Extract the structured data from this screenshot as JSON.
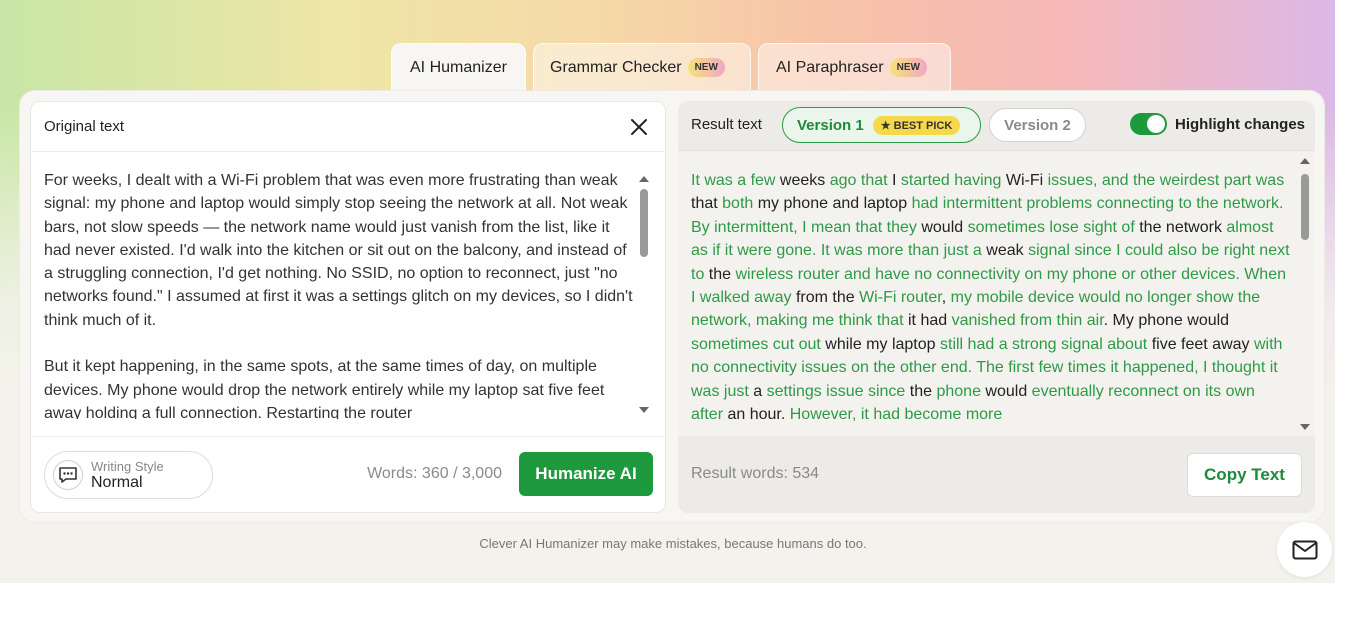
{
  "tabs": [
    {
      "label": "AI Humanizer",
      "badge": ""
    },
    {
      "label": "Grammar Checker",
      "badge": "NEW"
    },
    {
      "label": "AI Paraphraser",
      "badge": "NEW"
    }
  ],
  "input_panel": {
    "title": "Original text",
    "paragraphs": [
      "For weeks, I dealt with a Wi-Fi problem that was even more frustrating than weak signal: my phone and laptop would simply stop seeing the network at all. Not weak bars, not slow speeds — the network name would just vanish from the list, like it had never existed. I'd walk into the kitchen or sit out on the balcony, and instead of a struggling connection, I'd get nothing. No SSID, no option to reconnect, just \"no networks found.\" I assumed at first it was a settings glitch on my devices, so I didn't think much of it.",
      "But it kept happening, in the same spots, at the same times of day, on multiple devices. My phone would drop the network entirely while my laptop sat five feet away holding a full connection. Restarting the router"
    ],
    "writing_style_label": "Writing Style",
    "writing_style_value": "Normal",
    "word_count": "Words: 360 / 3,000",
    "humanize_button": "Humanize AI"
  },
  "result_panel": {
    "title": "Result text",
    "version1_label": "Version 1",
    "best_pick_badge": "★ BEST PICK",
    "version2_label": "Version 2",
    "highlight_label": "Highlight changes",
    "highlight_on": true,
    "segments": [
      {
        "t": "It was a few",
        "c": true
      },
      {
        "t": " weeks ",
        "c": false
      },
      {
        "t": "ago that",
        "c": true
      },
      {
        "t": " I ",
        "c": false
      },
      {
        "t": "started having",
        "c": true
      },
      {
        "t": " Wi-Fi ",
        "c": false
      },
      {
        "t": "issues, and the weirdest part was",
        "c": true
      },
      {
        "t": " that ",
        "c": false
      },
      {
        "t": "both",
        "c": true
      },
      {
        "t": " my phone and laptop ",
        "c": false
      },
      {
        "t": "had intermittent problems connecting to the network. By intermittent, I mean that they",
        "c": true
      },
      {
        "t": " would ",
        "c": false
      },
      {
        "t": "sometimes lose sight of",
        "c": true
      },
      {
        "t": " the network ",
        "c": false
      },
      {
        "t": "almost as if it were gone. It was more than just a",
        "c": true
      },
      {
        "t": " weak ",
        "c": false
      },
      {
        "t": "signal since I could also be right next to",
        "c": true
      },
      {
        "t": " the ",
        "c": false
      },
      {
        "t": "wireless router and have no connectivity on my phone or other devices. When I walked away",
        "c": true
      },
      {
        "t": " from the ",
        "c": false
      },
      {
        "t": "Wi-Fi router",
        "c": true
      },
      {
        "t": ", ",
        "c": false
      },
      {
        "t": "my mobile device would no longer show the network, making me think that",
        "c": true
      },
      {
        "t": " it had ",
        "c": false
      },
      {
        "t": "vanished from thin air",
        "c": true
      },
      {
        "t": ". My phone would ",
        "c": false
      },
      {
        "t": "sometimes cut out",
        "c": true
      },
      {
        "t": " while my laptop ",
        "c": false
      },
      {
        "t": "still had a strong signal about",
        "c": true
      },
      {
        "t": " five feet away ",
        "c": false
      },
      {
        "t": "with no connectivity issues on the other end. The first few times it happened, I thought it was just",
        "c": true
      },
      {
        "t": " a ",
        "c": false
      },
      {
        "t": "settings issue since",
        "c": true
      },
      {
        "t": " the ",
        "c": false
      },
      {
        "t": "phone",
        "c": true
      },
      {
        "t": " would ",
        "c": false
      },
      {
        "t": "eventually reconnect on its own after",
        "c": true
      },
      {
        "t": " an hour. ",
        "c": false
      },
      {
        "t": "However, it had become more",
        "c": true
      }
    ],
    "result_words": "Result words: 534",
    "copy_button": "Copy Text"
  },
  "disclaimer": "Clever AI Humanizer may make mistakes, because humans do too.",
  "colors": {
    "accent_green": "#1e9a3e",
    "changed_text": "#2e9a46",
    "best_pick": "#f6d94a"
  },
  "icons": {
    "close": "close-icon",
    "writing_style": "chat-bubble-icon",
    "mail": "mail-icon"
  }
}
